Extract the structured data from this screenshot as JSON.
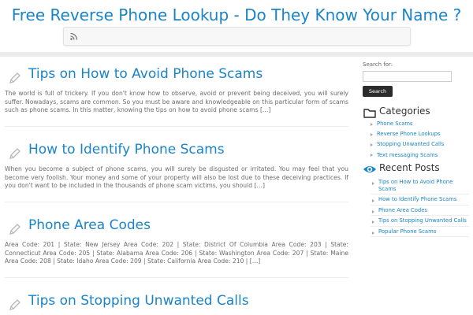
{
  "header": {
    "site_title": "Free Reverse Phone Lookup - Do They Know Your Name ?",
    "rss_icon": "rss-icon"
  },
  "posts": [
    {
      "title": "Tips on How to Avoid Phone Scams",
      "excerpt": "The world is full of trickery. If you don't know how to observe, avoid or prevent being deceived, you will surely suffer. Nowadays, scams are common. So you must be aware and knowledgeable on this particular form of scams such as phone scams. In this matter, knowing the tips on how to avoid phone scams […]"
    },
    {
      "title": "How to Identify Phone Scams",
      "excerpt": "When you become a subject of phone scams, you will surely be disgusted or irritated. You may feel that you become very foolish. Your money and some of your property will also be lost due to these deceiving practices. If you don't want to be included in the thousands of phone scam victims, you should […]"
    },
    {
      "title": "Phone Area Codes",
      "excerpt": "Area Code: 201 | State: New Jersey Area Code: 202 | State: District Of Columbia Area Code: 203 | State: Connecticut Area Code: 205 | State: Alabama Area Code: 206 | State: Washington Area Code: 207 | State: Maine Area Code: 208 | State: Idaho Area Code: 209 | State: California Area Code: 210 | […]"
    },
    {
      "title": "Tips on Stopping Unwanted Calls",
      "excerpt": ""
    }
  ],
  "sidebar": {
    "search_label": "Search for:",
    "search_value": "",
    "search_button": "Search",
    "categories_title": "Categories",
    "categories": [
      "Phone Scams",
      "Reverse Phone Lookups",
      "Stopping Unwanted Calls",
      "Text messaging Scams"
    ],
    "recent_title": "Recent Posts",
    "recent_posts": [
      "Tips on How to Avoid Phone Scams",
      "How to Identify Phone Scams",
      "Phone Area Codes",
      "Tips on Stopping Unwanted Calls",
      "Popular Phone Scams"
    ]
  },
  "colors": {
    "accent": "#1a84c7",
    "button_bg": "#2b2b2b"
  }
}
